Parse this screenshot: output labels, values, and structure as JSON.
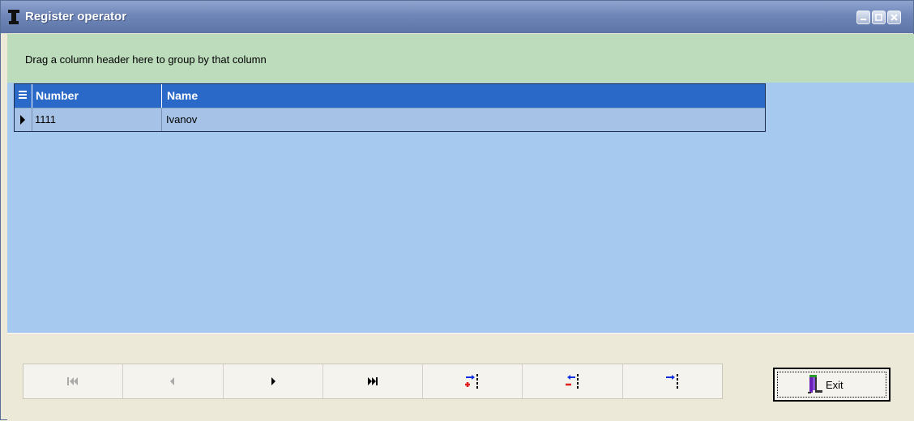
{
  "window": {
    "title": "Register operator",
    "controls": [
      "minimize-icon",
      "restore-icon",
      "close-icon"
    ]
  },
  "group_panel": {
    "hint": "Drag a column header here to group by that column"
  },
  "grid": {
    "columns": [
      {
        "label": "Number"
      },
      {
        "label": "Name"
      }
    ],
    "rows": [
      {
        "number": "1111",
        "name": "Ivanov"
      }
    ]
  },
  "navigator": {
    "buttons": [
      {
        "icon": "first-record-icon",
        "enabled": false
      },
      {
        "icon": "prior-record-icon",
        "enabled": false
      },
      {
        "icon": "next-record-icon",
        "enabled": true
      },
      {
        "icon": "last-record-icon",
        "enabled": true
      },
      {
        "icon": "insert-record-icon",
        "enabled": true
      },
      {
        "icon": "delete-record-icon",
        "enabled": true
      },
      {
        "icon": "post-record-icon",
        "enabled": true
      }
    ]
  },
  "exit_button": {
    "label": "Exit",
    "icon": "exit-door-icon"
  },
  "colors": {
    "header": "#2b69c8",
    "grid_background": "#a6c9ef",
    "group_panel": "#bcdcbc"
  }
}
